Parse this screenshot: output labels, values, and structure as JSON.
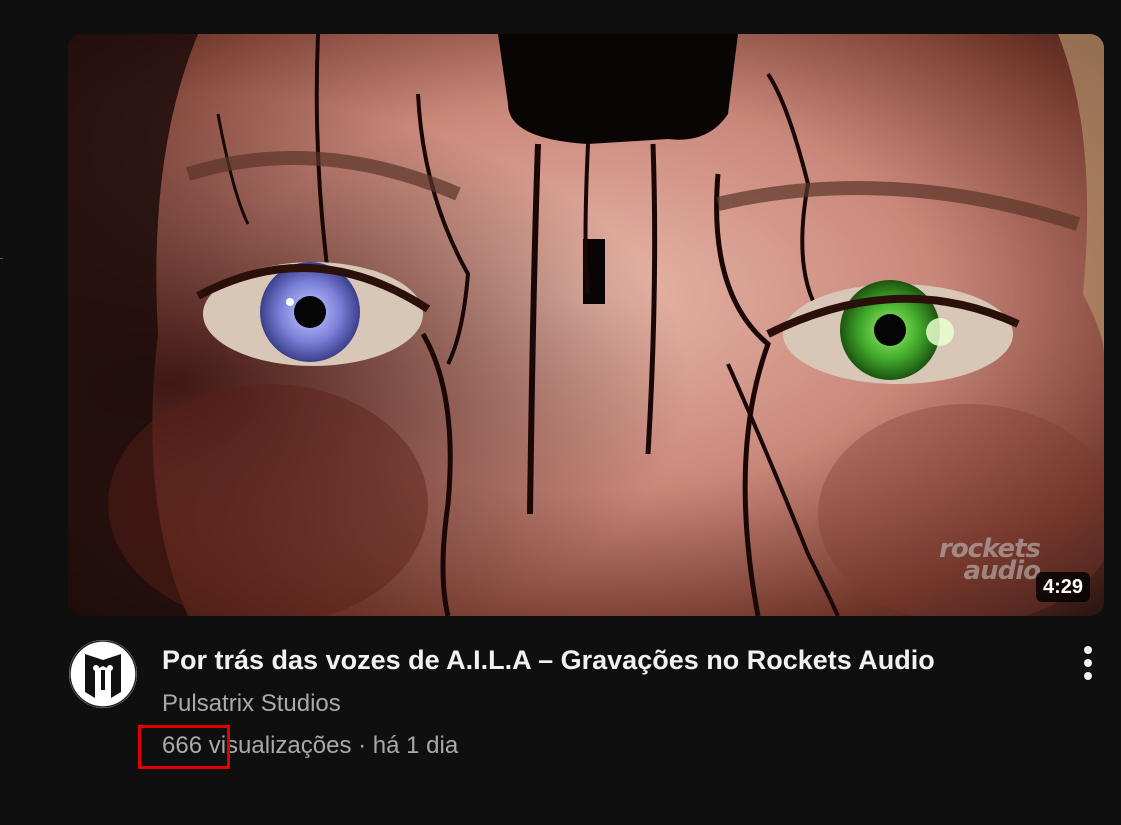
{
  "video": {
    "title": "Por trás das vozes de A.I.L.A – Gravações no Rockets Audio",
    "duration": "4:29",
    "thumbnail_watermark_line1": "rockets",
    "thumbnail_watermark_line2": "audio",
    "thumbnail_icon": "face-with-mismatched-eyes-image"
  },
  "channel": {
    "name": "Pulsatrix Studios",
    "avatar_icon": "pulsatrix-logo-icon"
  },
  "stats": {
    "views": "666 visualizações",
    "separator": " · ",
    "age": "há 1 dia"
  },
  "actions": {
    "more_icon": "more-vert-icon"
  },
  "annotation": {
    "highlight_color": "#e00000"
  },
  "colors": {
    "background": "#0f0f0f",
    "title": "#f1f1f1",
    "secondary_text": "#aaaaaa"
  }
}
